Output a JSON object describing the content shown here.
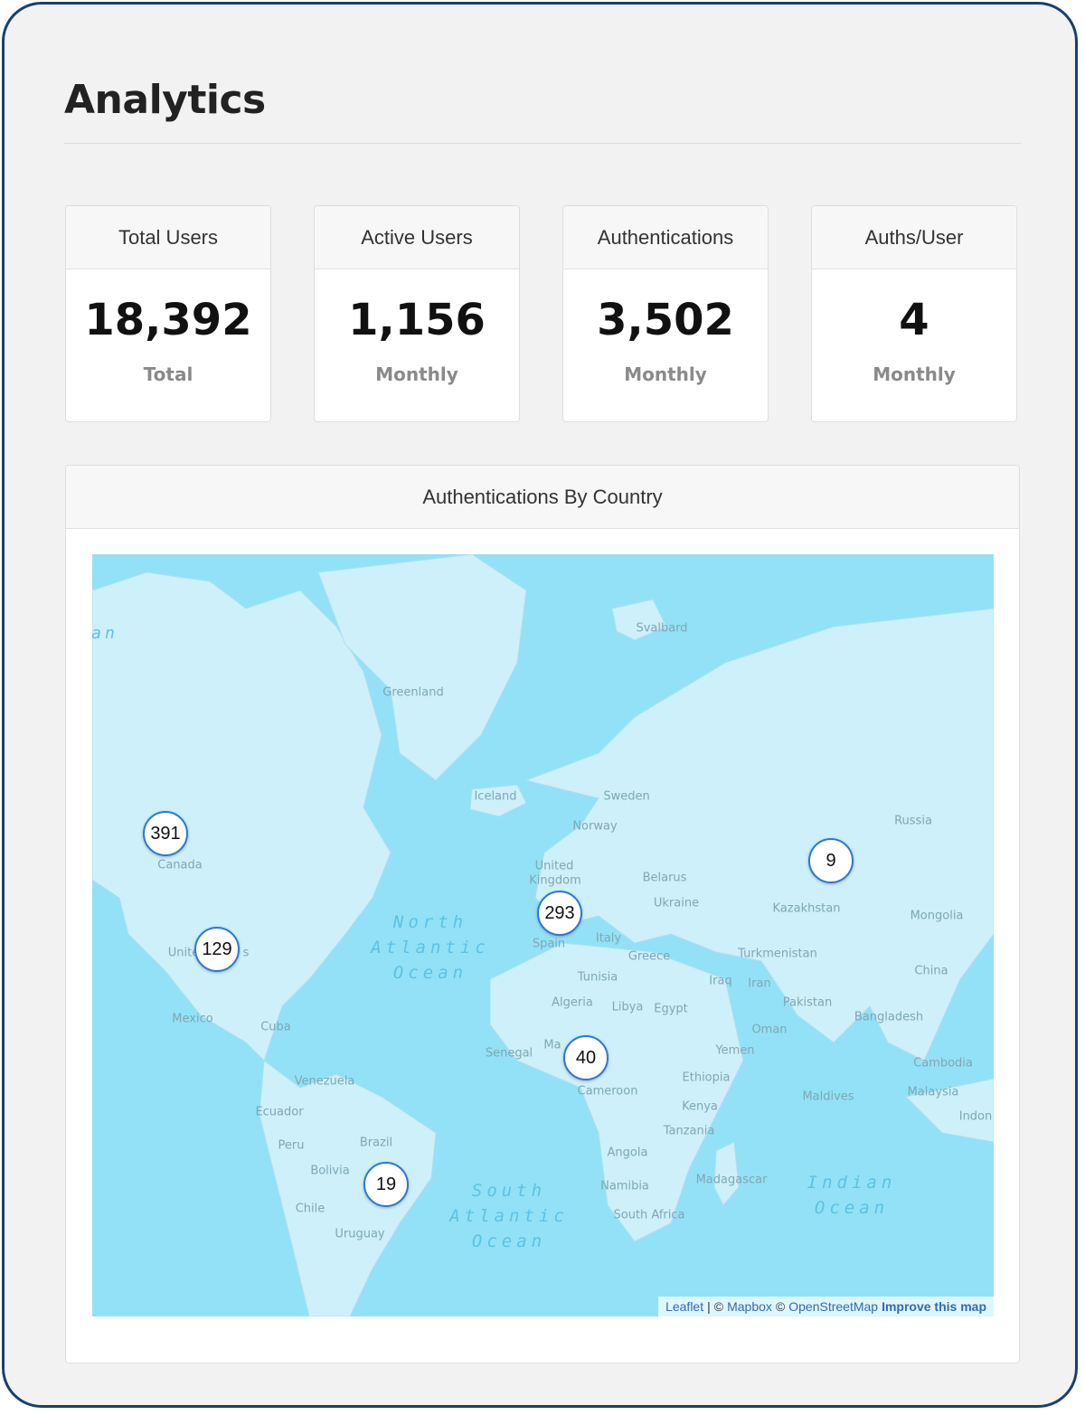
{
  "page": {
    "title": "Analytics"
  },
  "stats": [
    {
      "label": "Total Users",
      "value": "18,392",
      "sub": "Total"
    },
    {
      "label": "Active Users",
      "value": "1,156",
      "sub": "Monthly"
    },
    {
      "label": "Authentications",
      "value": "3,502",
      "sub": "Monthly"
    },
    {
      "label": "Auths/User",
      "value": "4",
      "sub": "Monthly"
    }
  ],
  "map_card": {
    "title": "Authentications By Country",
    "labels": {
      "svalbard": "Svalbard",
      "greenland": "Greenland",
      "iceland": "Iceland",
      "sweden": "Sweden",
      "norway": "Norway",
      "russia": "Russia",
      "united_kingdom_1": "United",
      "united_kingdom_2": "Kingdom",
      "belarus": "Belarus",
      "ukraine": "Ukraine",
      "kazakhstan": "Kazakhstan",
      "mongolia": "Mongolia",
      "canada": "Canada",
      "united_states": "Unite",
      "united_states_end": "s",
      "spain": "Spain",
      "italy": "Italy",
      "greece": "Greece",
      "turkmenistan": "Turkmenistan",
      "tunisia": "Tunisia",
      "iraq": "Iraq",
      "iran": "Iran",
      "china": "China",
      "algeria": "Algeria",
      "libya": "Libya",
      "egypt": "Egypt",
      "pakistan": "Pakistan",
      "mexico": "Mexico",
      "cuba": "Cuba",
      "oman": "Oman",
      "bangladesh": "Bangladesh",
      "senegal": "Senegal",
      "mali": "Ma",
      "yemen": "Yemen",
      "cambodia": "Cambodia",
      "venezuela": "Venezuela",
      "ethiopia": "Ethiopia",
      "ecuador": "Ecuador",
      "cameroon": "Cameroon",
      "maldives": "Maldives",
      "malaysia": "Malaysia",
      "kenya": "Kenya",
      "indonesia": "Indon",
      "brazil": "Brazil",
      "tanzania": "Tanzania",
      "peru": "Peru",
      "angola": "Angola",
      "bolivia": "Bolivia",
      "madagascar": "Madagascar",
      "namibia": "Namibia",
      "chile": "Chile",
      "south_africa": "South Africa",
      "uruguay": "Uruguay",
      "edge_letters": "an"
    },
    "oceans": {
      "north_atlantic": "North\nAtlantic\nOcean",
      "south_atlantic": "South\nAtlantic\nOcean",
      "indian": "Indian\nOcean"
    },
    "markers": {
      "canada": "391",
      "united_states": "129",
      "europe": "293",
      "russia": "9",
      "west_africa": "40",
      "brazil": "19"
    },
    "attribution": {
      "leaflet": "Leaflet",
      "sep1": "|",
      "copy1": "©",
      "mapbox": "Mapbox",
      "copy2": "©",
      "osm": "OpenStreetMap",
      "improve": "Improve this map"
    }
  },
  "colors": {
    "frame": "#17406e",
    "water": "#93e1f6",
    "land": "#cdf0fa",
    "marker_border": "#2a78d6"
  }
}
